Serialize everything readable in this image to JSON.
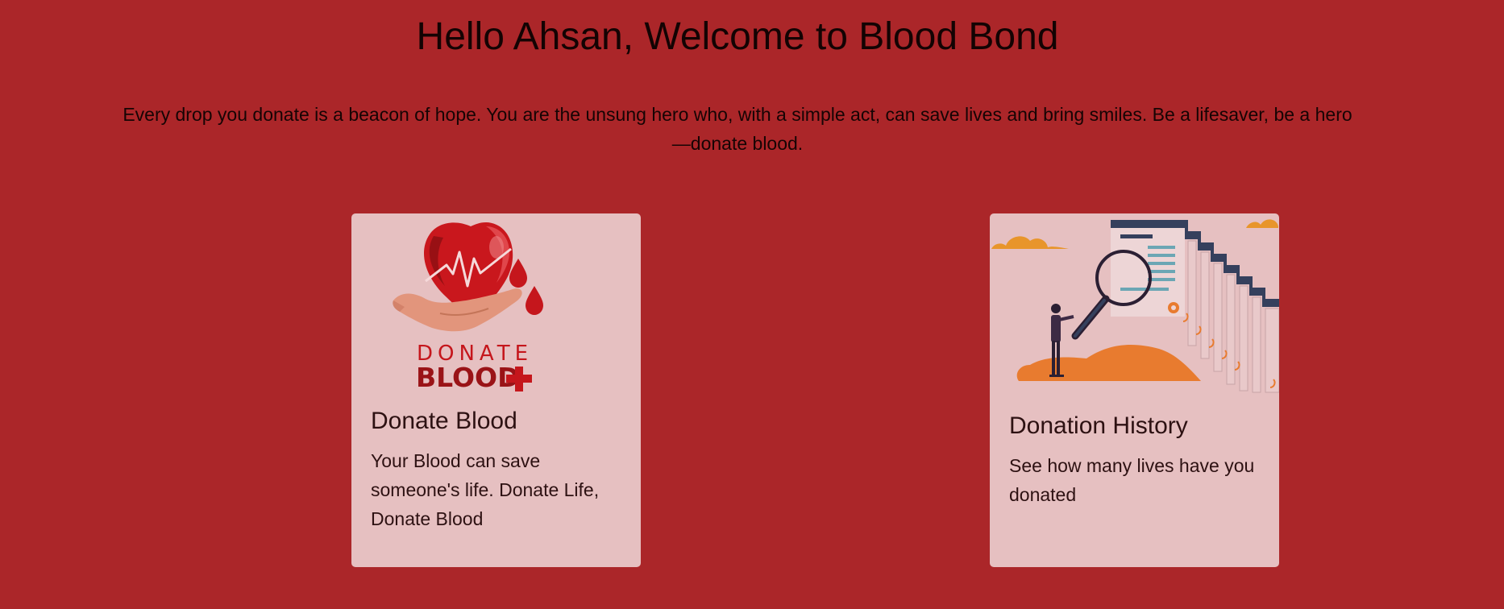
{
  "header": {
    "title": "Hello Ahsan, Welcome to Blood Bond",
    "intro": "Every drop you donate is a beacon of hope. You are the unsung hero who, with a simple act, can save lives and bring smiles. Be a lifesaver, be a hero—donate blood."
  },
  "cards": [
    {
      "title": "Donate Blood",
      "description": "Your Blood can save someone's life. Donate Life, Donate Blood",
      "image_icon": "heart-in-hand-donate-blood-logo",
      "image_text": [
        "DONATE",
        "BLOOD"
      ]
    },
    {
      "title": "Donation History",
      "description": "See how many lives have you donated",
      "image_icon": "magnifying-glass-documents-illustration"
    }
  ],
  "colors": {
    "page_background": "#ab2629",
    "card_background": "#e6c0c1",
    "card_text": "#2d1112",
    "accent_orange": "#e87b2f",
    "document_navy": "#35405d"
  }
}
